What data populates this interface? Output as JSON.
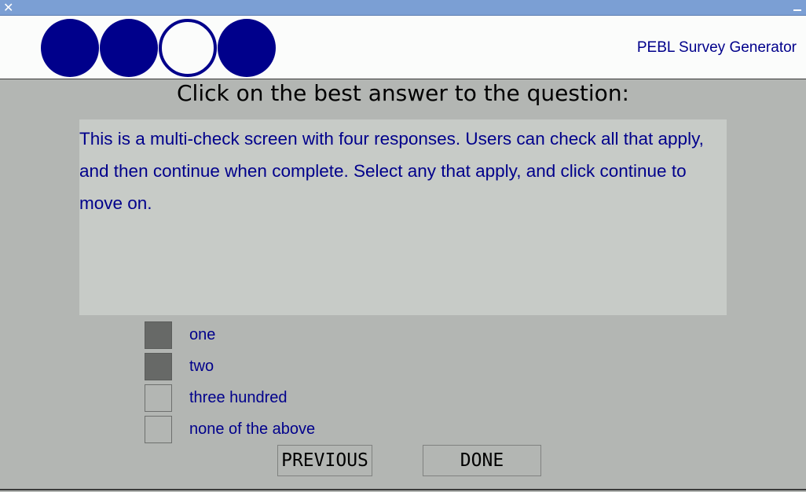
{
  "titlebar": {
    "close_glyph": "✕"
  },
  "header": {
    "brand": "PEBL Survey Generator",
    "progress": [
      {
        "state": "filled"
      },
      {
        "state": "filled"
      },
      {
        "state": "empty"
      },
      {
        "state": "filled"
      }
    ]
  },
  "prompt": "Click on the best answer to the question:",
  "question": "This is a multi-check screen with four responses.  Users can check all that apply, and then continue when complete. Select any that apply, and click continue to move on.",
  "options": [
    {
      "label": "one",
      "checked": true
    },
    {
      "label": "two",
      "checked": true
    },
    {
      "label": "three hundred",
      "checked": false
    },
    {
      "label": "none of the above",
      "checked": false
    }
  ],
  "buttons": {
    "previous": "PREVIOUS",
    "done": "DONE"
  },
  "colors": {
    "accent": "#00008b",
    "background": "#b3b6b3",
    "question_box": "#c7cbc7",
    "checked_box": "#676967",
    "titlebar": "#7b9fd4"
  }
}
